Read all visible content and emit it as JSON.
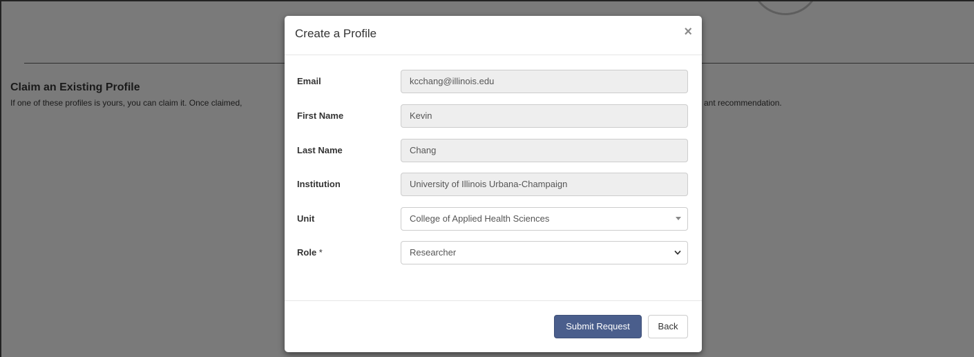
{
  "background": {
    "section_title": "Claim an Existing Profile",
    "section_text_left": "If one of these profiles is yours, you can claim it. Once claimed,",
    "section_text_right": "ant recommendation."
  },
  "modal": {
    "title": "Create a Profile",
    "close_glyph": "×",
    "fields": {
      "email": {
        "label": "Email",
        "value": "kcchang@illinois.edu"
      },
      "first_name": {
        "label": "First Name",
        "value": "Kevin"
      },
      "last_name": {
        "label": "Last Name",
        "value": "Chang"
      },
      "institution": {
        "label": "Institution",
        "value": "University of Illinois Urbana-Champaign"
      },
      "unit": {
        "label": "Unit",
        "value": "College of Applied Health Sciences"
      },
      "role": {
        "label": "Role",
        "required_marker": "*",
        "value": "Researcher"
      }
    },
    "footer": {
      "submit_label": "Submit Request",
      "back_label": "Back"
    }
  },
  "colors": {
    "overlay_background": "#7a7a7a",
    "primary_button": "#4a5e8c",
    "readonly_field": "#eeeeee"
  }
}
